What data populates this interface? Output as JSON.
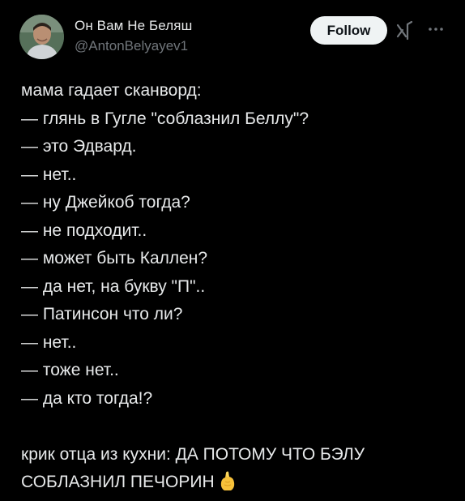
{
  "author": {
    "display_name": "Он Вам Не Беляш",
    "handle": "@AntonBelyayev1",
    "avatar_icon": "avatar-photo"
  },
  "actions": {
    "follow_label": "Follow",
    "grok_icon": "grok-icon",
    "more_icon": "more-options-icon"
  },
  "post": {
    "lines": [
      "мама гадает сканворд:",
      "— глянь в Гугле \"соблазнил Беллу\"?",
      "— это Эдвард.",
      "— нет..",
      "— ну Джейкоб тогда?",
      "— не подходит..",
      "— может быть Каллен?",
      "— да нет, на букву \"П\"..",
      "— Патинсон что ли?",
      "— нет..",
      "— тоже нет..",
      "— да кто тогда!?"
    ],
    "punchline_1": "крик отца из кухни: ДА ПОТОМУ ЧТО БЭЛУ",
    "punchline_2": "СОБЛАЗНИЛ ПЕЧОРИН",
    "emoji_icon": "pinched-fingers-emoji"
  },
  "colors": {
    "background": "#000000",
    "text": "#e7e9ea",
    "secondary_text": "#71767b",
    "follow_bg": "#eff3f4",
    "follow_text": "#0f1419"
  }
}
